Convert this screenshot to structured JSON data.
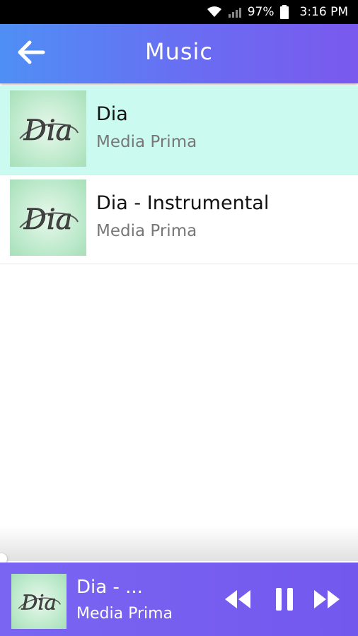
{
  "status_bar": {
    "battery": "97%",
    "time": "3:16 PM"
  },
  "app_bar": {
    "title": "Music"
  },
  "tracks": [
    {
      "title": "Dia",
      "artist": "Media Prima",
      "art_text": "Dia",
      "active": true
    },
    {
      "title": "Dia - Instrumental",
      "artist": "Media Prima",
      "art_text": "Dia",
      "active": false
    }
  ],
  "player": {
    "title": "Dia - ...",
    "artist": "Media Prima",
    "art_text": "Dia",
    "progress": 0.0
  },
  "icons": {
    "back": "arrow-left-icon",
    "wifi": "wifi-icon",
    "signal": "signal-icon",
    "battery": "battery-icon",
    "rewind": "rewind-icon",
    "pause": "pause-icon",
    "forward": "fast-forward-icon"
  },
  "colors": {
    "accent_start": "#4f8ff5",
    "accent_end": "#7a59ee",
    "active_row": "#cbfaf1",
    "player_bg": "#7358ee"
  }
}
